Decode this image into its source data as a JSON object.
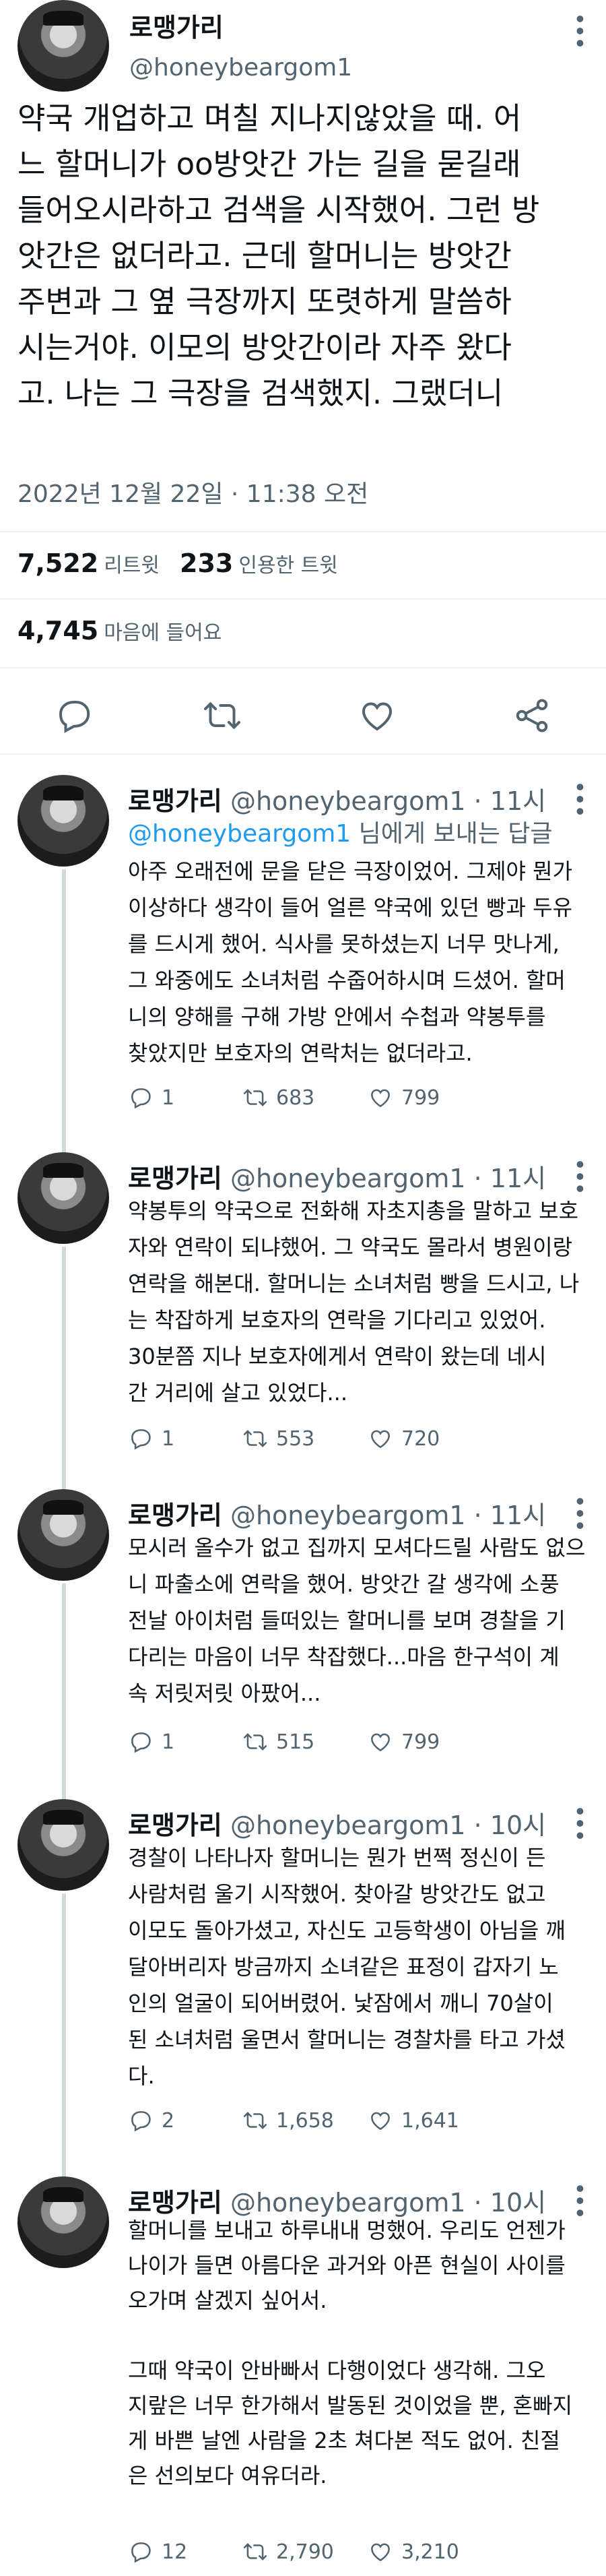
{
  "main": {
    "name": "로맹가리",
    "handle": "@honeybeargom1",
    "text": "약국 개업하고 며칠 지나지않았을 때. 어\n느 할머니가 oo방앗간 가는 길을 묻길래\n들어오시라하고 검색을 시작했어. 그런 방\n앗간은 없더라고. 근데 할머니는 방앗간\n주변과 그 옆 극장까지 또렷하게 말씀하\n시는거야. 이모의 방앗간이라 자주 왔다\n고. 나는 그 극장을 검색했지. 그랬더니",
    "timestamp": "2022년 12월 22일 · 11:38 오전",
    "retweets": "7,522",
    "retweets_label": "리트윗",
    "quotes": "233",
    "quotes_label": "인용한 트윗",
    "likes": "4,745",
    "likes_label": "마음에 들어요"
  },
  "replies": [
    {
      "name": "로맹가리",
      "handle": "@honeybeargom1",
      "time": "· 11시",
      "reply_to_handle": "@honeybeargom1",
      "reply_to_suffix": " 님에게 보내는 답글",
      "text": "아주 오래전에 문을 닫은 극장이었어. 그제야 뭔가\n이상하다 생각이 들어 얼른 약국에 있던 빵과 두유\n를 드시게 했어. 식사를 못하셨는지 너무 맛나게,\n그 와중에도 소녀처럼 수줍어하시며 드셨어. 할머\n니의 양해를 구해 가방 안에서 수첩과 약봉투를\n찾았지만 보호자의 연락처는 없더라고.",
      "reply_count": "1",
      "retweet_count": "683",
      "like_count": "799"
    },
    {
      "name": "로맹가리",
      "handle": "@honeybeargom1",
      "time": "· 11시",
      "text": "약봉투의 약국으로 전화해 자초지총을 말하고 보호\n자와 연락이 되냐했어. 그 약국도 몰라서 병원이랑\n연락을 해본대. 할머니는 소녀처럼 빵을 드시고, 나\n는 착잡하게 보호자의 연락을 기다리고 있었어.\n30분쯤 지나 보호자에게서 연락이 왔는데 네시\n간 거리에 살고 있었다...",
      "reply_count": "1",
      "retweet_count": "553",
      "like_count": "720"
    },
    {
      "name": "로맹가리",
      "handle": "@honeybeargom1",
      "time": "· 11시",
      "text": "모시러 올수가 없고 집까지 모셔다드릴 사람도 없으\n니 파출소에 연락을 했어. 방앗간 갈 생각에 소풍\n전날 아이처럼 들떠있는 할머니를 보며 경찰을 기\n다리는 마음이 너무 착잡했다...마음 한구석이 계\n속 저릿저릿 아팠어...",
      "reply_count": "1",
      "retweet_count": "515",
      "like_count": "799"
    },
    {
      "name": "로맹가리",
      "handle": "@honeybeargom1",
      "time": "· 10시",
      "text": "경찰이 나타나자 할머니는 뭔가 번쩍 정신이 든\n사람처럼 울기 시작했어. 찾아갈 방앗간도 없고\n이모도 돌아가셨고, 자신도 고등학생이 아님을 깨\n달아버리자 방금까지 소녀같은 표정이 갑자기 노\n인의 얼굴이 되어버렸어. 낯잠에서 깨니 70살이\n된 소녀처럼 울면서 할머니는 경찰차를 타고 가셨\n다.",
      "reply_count": "2",
      "retweet_count": "1,658",
      "like_count": "1,641"
    },
    {
      "name": "로맹가리",
      "handle": "@honeybeargom1",
      "time": "· 10시",
      "text": "할머니를 보내고 하루내내 멍했어. 우리도 언젠가\n나이가 들면 아름다운 과거와 아픈 현실이 사이를\n오가며 살겠지 싶어서.\n\n그때 약국이 안바빠서 다행이었다 생각해. 그오\n지랖은 너무 한가해서 발동된 것이었을 뿐, 혼빠지\n게 바쁜 날엔 사람을 2초 쳐다본 적도 없어. 친절\n은 선의보다 여유더라.",
      "reply_count": "12",
      "retweet_count": "2,790",
      "like_count": "3,210"
    }
  ],
  "icons": {
    "reply": "reply-icon",
    "retweet": "retweet-icon",
    "like": "heart-icon",
    "share": "share-icon",
    "more": "more-icon"
  }
}
